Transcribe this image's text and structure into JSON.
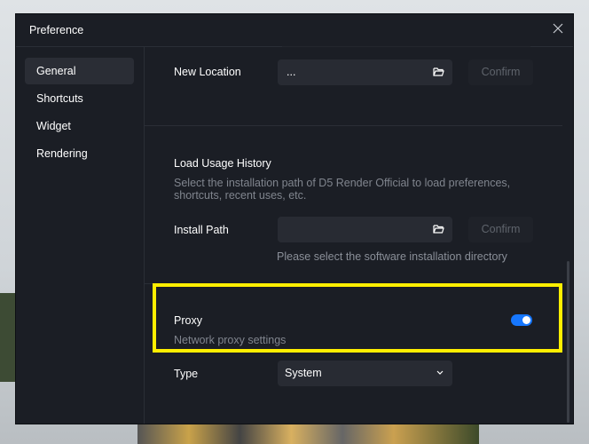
{
  "dialog": {
    "title": "Preference",
    "close_icon": "close-icon"
  },
  "sidebar": {
    "items": [
      {
        "label": "General",
        "active": true
      },
      {
        "label": "Shortcuts"
      },
      {
        "label": "Widget"
      },
      {
        "label": "Rendering"
      }
    ]
  },
  "new_location": {
    "label": "New Location",
    "value": "...",
    "confirm": "Confirm"
  },
  "usage_history": {
    "title": "Load Usage History",
    "description_line1": "Select the installation path of D5 Render Official to load preferences,",
    "description_line2": "shortcuts, recent uses, etc.",
    "install_path_label": "Install Path",
    "install_path_value": "",
    "confirm": "Confirm",
    "helper": "Please select the software installation directory"
  },
  "proxy": {
    "label": "Proxy",
    "description": "Network proxy settings",
    "enabled": true,
    "toggle_color": "#1677ff",
    "highlight_color": "#ffee00"
  },
  "type": {
    "label": "Type",
    "value": "System"
  }
}
